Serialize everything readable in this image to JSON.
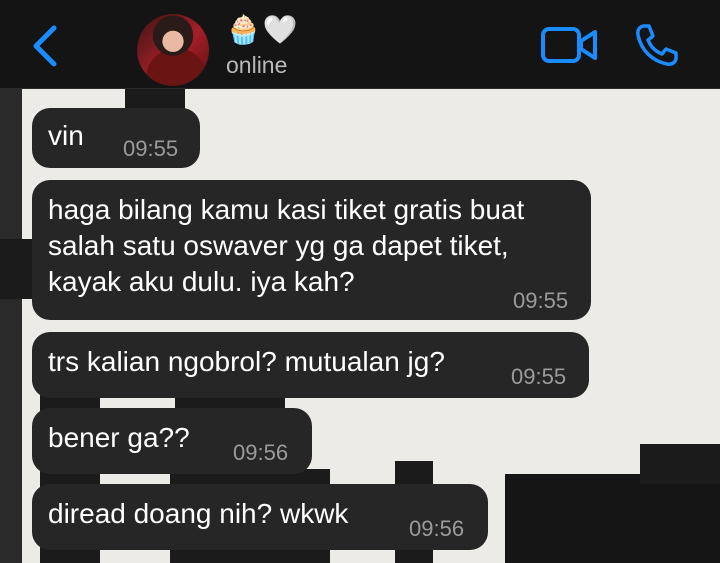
{
  "header": {
    "back_icon": "chevron-left-icon",
    "contact_emoji": [
      "🧁",
      "🤍"
    ],
    "status": "online",
    "video_icon": "video-camera-icon",
    "call_icon": "phone-icon",
    "accent_color": "#1a8cff"
  },
  "messages": [
    {
      "text": "vin",
      "time": "09:55"
    },
    {
      "text": "haga bilang kamu kasi tiket gratis buat\nsalah satu oswaver yg ga dapet tiket,\nkayak aku dulu. iya kah?",
      "time": "09:55"
    },
    {
      "text": "trs kalian ngobrol? mutualan jg?",
      "time": "09:55"
    },
    {
      "text": "bener ga??",
      "time": "09:56"
    },
    {
      "text": "diread doang nih? wkwk",
      "time": "09:56"
    }
  ]
}
